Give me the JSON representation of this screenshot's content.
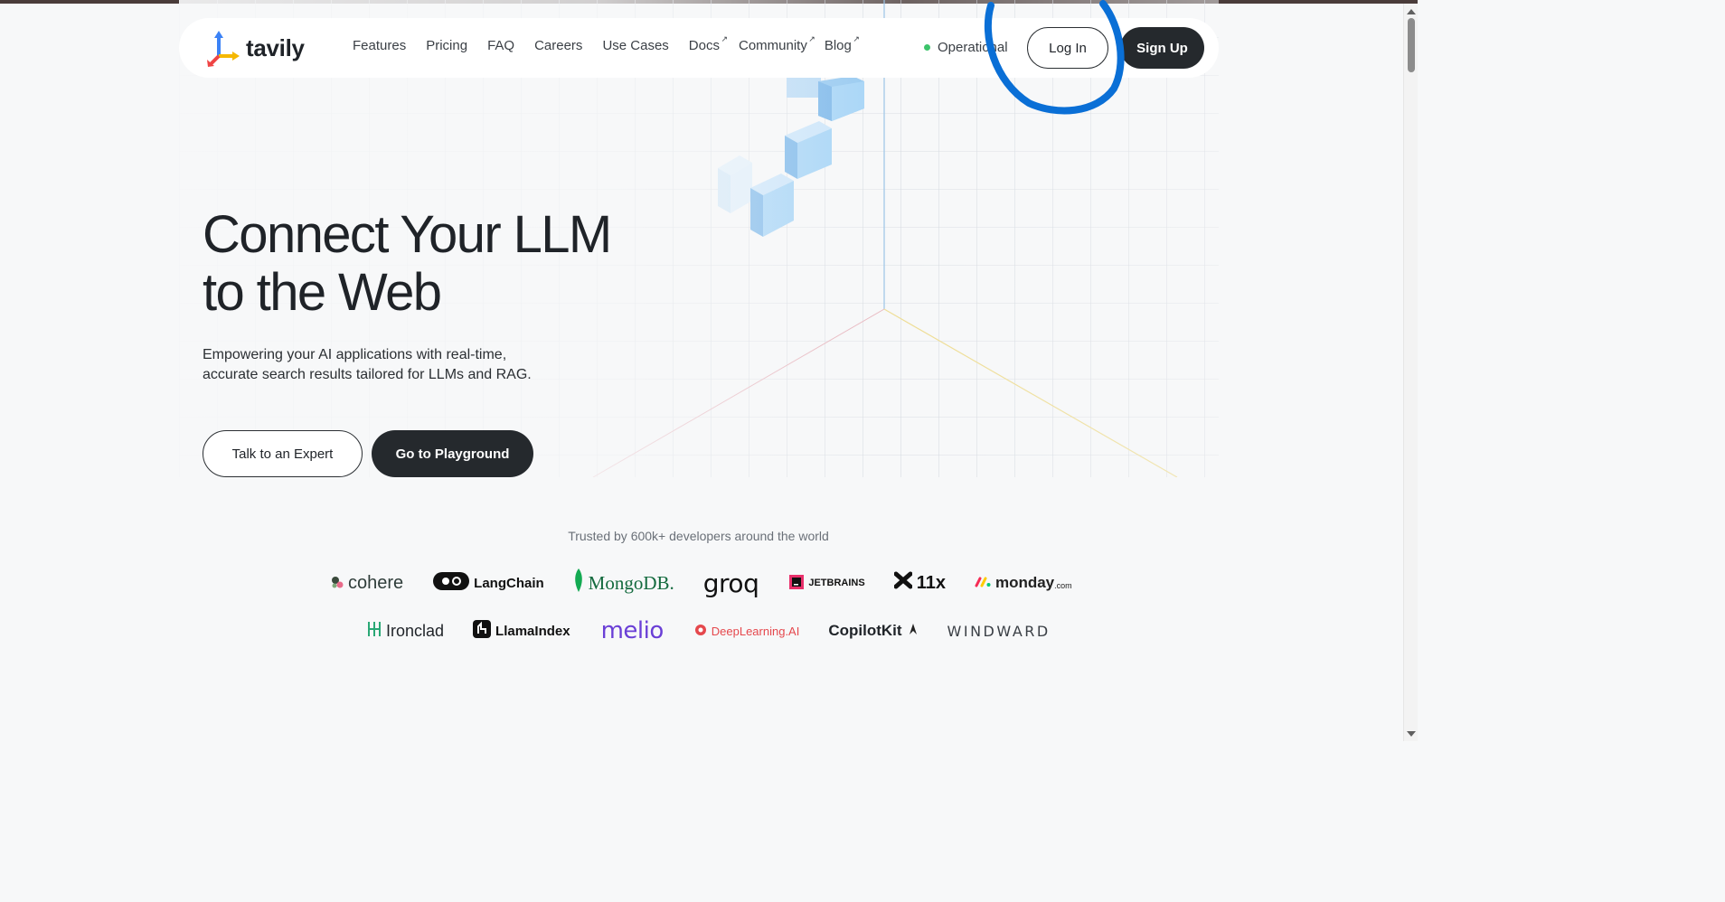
{
  "nav": {
    "brand": "tavily",
    "links": [
      {
        "label": "Features",
        "external": false
      },
      {
        "label": "Pricing",
        "external": false
      },
      {
        "label": "FAQ",
        "external": false
      },
      {
        "label": "Careers",
        "external": false
      },
      {
        "label": "Use Cases",
        "external": false
      },
      {
        "label": "Docs",
        "external": true
      },
      {
        "label": "Community",
        "external": true
      },
      {
        "label": "Blog",
        "external": true
      }
    ],
    "status_label": "Operational",
    "login_label": "Log In",
    "signup_label": "Sign Up",
    "external_icon": "↗"
  },
  "hero": {
    "headline_line1": "Connect Your LLM",
    "headline_line2": "to the Web",
    "subtitle_line1": "Empowering your AI applications with real-time,",
    "subtitle_line2": "accurate search results tailored for LLMs and RAG.",
    "expert_button": "Talk to an Expert",
    "playground_button": "Go to Playground"
  },
  "trusted": {
    "label": "Trusted by 600k+ developers around the world",
    "row1": [
      "cohere",
      "LangChain",
      "MongoDB.",
      "groq",
      "JETBRAINS",
      "11x",
      "monday"
    ],
    "row2": [
      "Ironclad",
      "LlamaIndex",
      "melio",
      "DeepLearning.AI",
      "CopilotKit",
      "WINDWARD"
    ],
    "monday_suffix": ".com"
  },
  "colors": {
    "dark_button": "#25292d",
    "status_green": "#3cc46b",
    "annotation_blue": "#0a6fd6",
    "cube_blue": "#8ec8f5"
  },
  "icons": [
    "tavily-logo-icon",
    "external-link-icon",
    "status-dot-icon",
    "cube-icon"
  ]
}
